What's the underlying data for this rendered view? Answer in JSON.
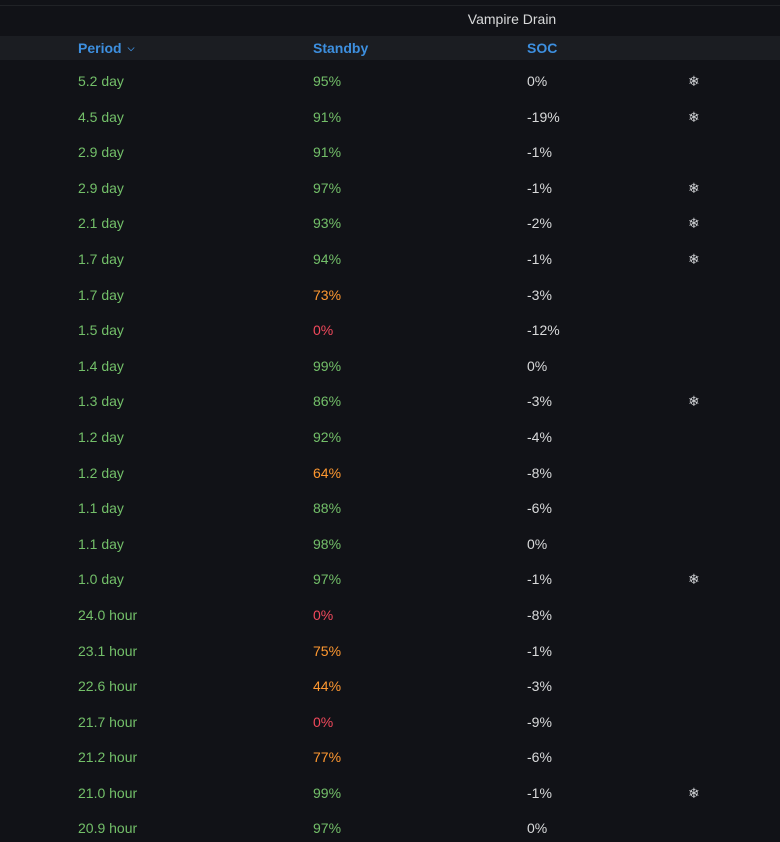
{
  "panel": {
    "title": "Vampire Drain"
  },
  "columns": {
    "period": "Period",
    "standby": "Standby",
    "soc": "SOC",
    "sort_icon": "chevron-down-icon"
  },
  "colors": {
    "good": "#73bf69",
    "warn": "#ff9830",
    "bad": "#f2495c",
    "neutral": "#d8d9da",
    "header_link": "#3d8fdf"
  },
  "rows": [
    {
      "period": "5.2 day",
      "standby": "95%",
      "standby_level": "good",
      "soc": "0%",
      "flag": "❄"
    },
    {
      "period": "4.5 day",
      "standby": "91%",
      "standby_level": "good",
      "soc": "-19%",
      "flag": "❄"
    },
    {
      "period": "2.9 day",
      "standby": "91%",
      "standby_level": "good",
      "soc": "-1%",
      "flag": ""
    },
    {
      "period": "2.9 day",
      "standby": "97%",
      "standby_level": "good",
      "soc": "-1%",
      "flag": "❄"
    },
    {
      "period": "2.1 day",
      "standby": "93%",
      "standby_level": "good",
      "soc": "-2%",
      "flag": "❄"
    },
    {
      "period": "1.7 day",
      "standby": "94%",
      "standby_level": "good",
      "soc": "-1%",
      "flag": "❄"
    },
    {
      "period": "1.7 day",
      "standby": "73%",
      "standby_level": "warn",
      "soc": "-3%",
      "flag": ""
    },
    {
      "period": "1.5 day",
      "standby": "0%",
      "standby_level": "bad",
      "soc": "-12%",
      "flag": ""
    },
    {
      "period": "1.4 day",
      "standby": "99%",
      "standby_level": "good",
      "soc": "0%",
      "flag": ""
    },
    {
      "period": "1.3 day",
      "standby": "86%",
      "standby_level": "good",
      "soc": "-3%",
      "flag": "❄"
    },
    {
      "period": "1.2 day",
      "standby": "92%",
      "standby_level": "good",
      "soc": "-4%",
      "flag": ""
    },
    {
      "period": "1.2 day",
      "standby": "64%",
      "standby_level": "warn",
      "soc": "-8%",
      "flag": ""
    },
    {
      "period": "1.1 day",
      "standby": "88%",
      "standby_level": "good",
      "soc": "-6%",
      "flag": ""
    },
    {
      "period": "1.1 day",
      "standby": "98%",
      "standby_level": "good",
      "soc": "0%",
      "flag": ""
    },
    {
      "period": "1.0 day",
      "standby": "97%",
      "standby_level": "good",
      "soc": "-1%",
      "flag": "❄"
    },
    {
      "period": "24.0 hour",
      "standby": "0%",
      "standby_level": "bad",
      "soc": "-8%",
      "flag": ""
    },
    {
      "period": "23.1 hour",
      "standby": "75%",
      "standby_level": "warn",
      "soc": "-1%",
      "flag": ""
    },
    {
      "period": "22.6 hour",
      "standby": "44%",
      "standby_level": "warn",
      "soc": "-3%",
      "flag": ""
    },
    {
      "period": "21.7 hour",
      "standby": "0%",
      "standby_level": "bad",
      "soc": "-9%",
      "flag": ""
    },
    {
      "period": "21.2 hour",
      "standby": "77%",
      "standby_level": "warn",
      "soc": "-6%",
      "flag": ""
    },
    {
      "period": "21.0 hour",
      "standby": "99%",
      "standby_level": "good",
      "soc": "-1%",
      "flag": "❄"
    },
    {
      "period": "20.9 hour",
      "standby": "97%",
      "standby_level": "good",
      "soc": "0%",
      "flag": ""
    }
  ]
}
